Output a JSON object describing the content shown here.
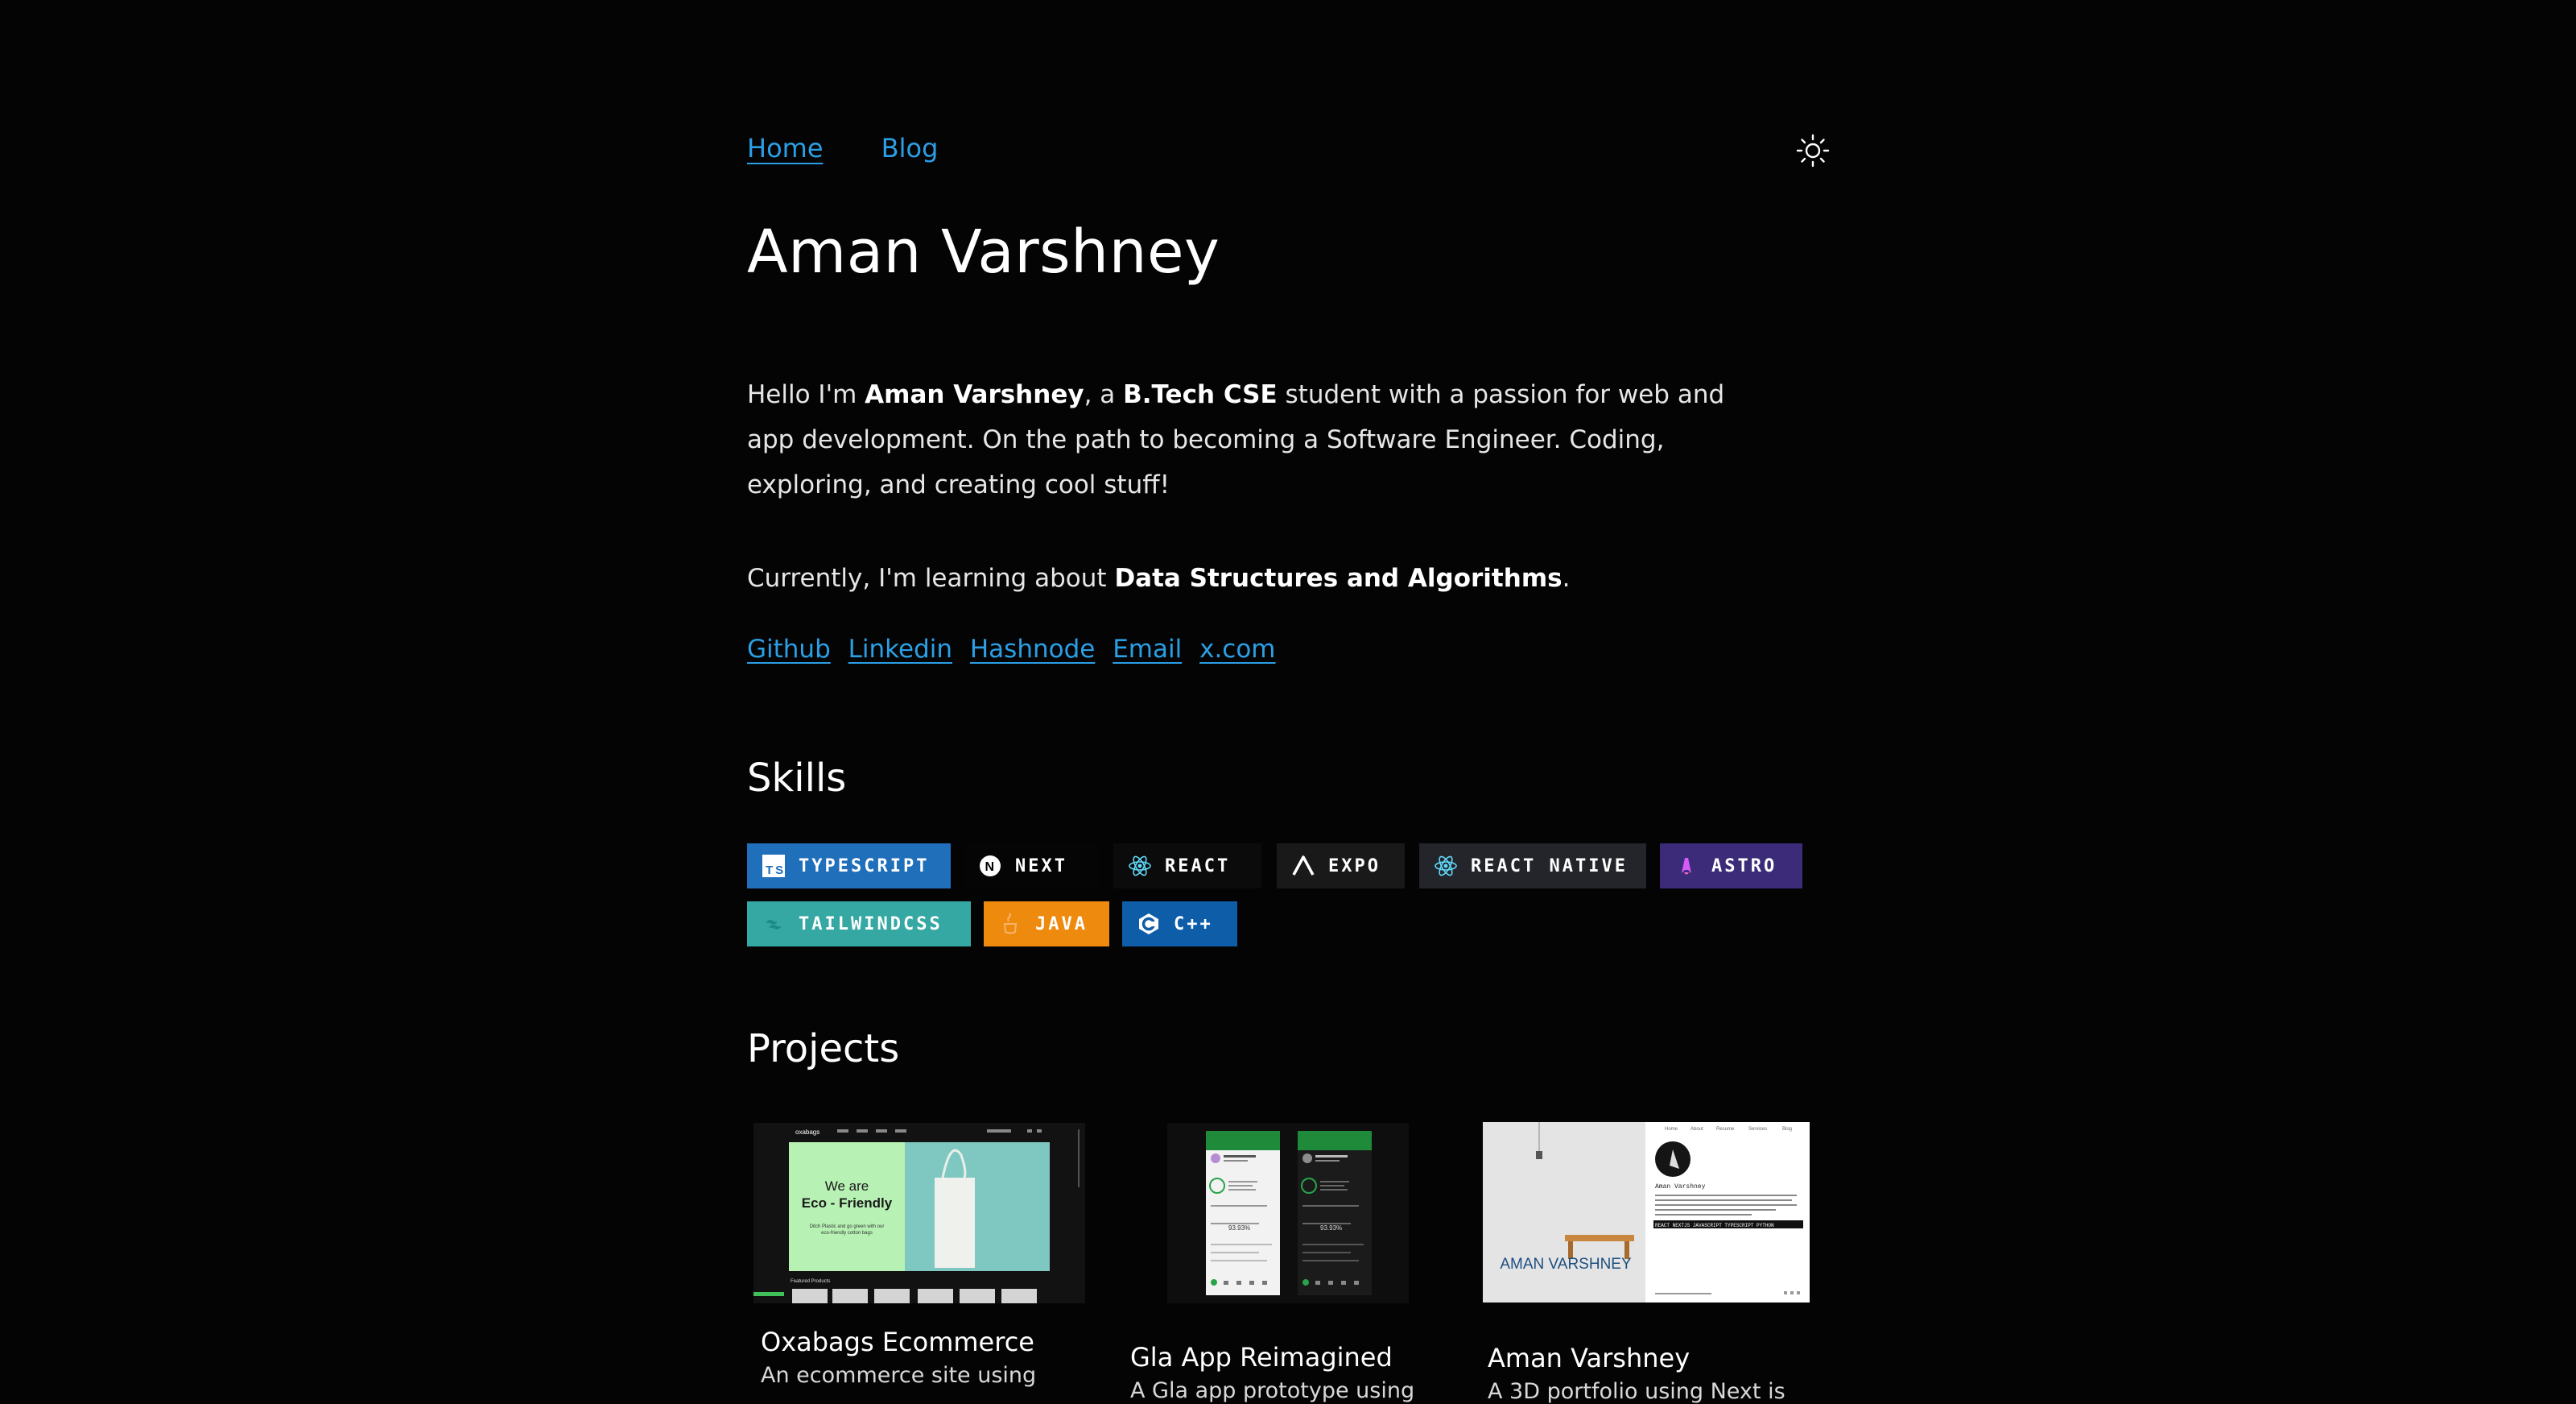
{
  "nav": {
    "home": "Home",
    "blog": "Blog",
    "theme_icon": "sun-icon"
  },
  "header": {
    "name": "Aman Varshney"
  },
  "intro": {
    "p1_a": "Hello I'm ",
    "p1_name": "Aman Varshney",
    "p1_b": ", a ",
    "p1_degree": "B.Tech CSE",
    "p1_c": " student with a passion for web and app development. On the path to becoming a Software Engineer. Coding, exploring, and creating cool stuff!",
    "p2_a": "Currently, I'm learning about ",
    "p2_topic": "Data Structures and Algorithms",
    "p2_b": "."
  },
  "links": [
    "Github",
    "Linkedin",
    "Hashnode",
    "Email",
    "x.com"
  ],
  "skills": {
    "heading": "Skills",
    "badges": [
      {
        "label": "TYPESCRIPT",
        "icon": "typescript-icon",
        "bg": "#1f6fba"
      },
      {
        "label": "NEXT",
        "icon": "nextjs-icon",
        "bg": "#050505"
      },
      {
        "label": "REACT",
        "icon": "react-icon",
        "bg": "#0b0b0b"
      },
      {
        "label": "EXPO",
        "icon": "expo-icon",
        "bg": "#191919"
      },
      {
        "label": "REACT NATIVE",
        "icon": "react-icon",
        "bg": "#23252b"
      },
      {
        "label": "ASTRO",
        "icon": "astro-icon",
        "bg": "#3c2b78"
      },
      {
        "label": "TAILWINDCSS",
        "icon": "tailwind-icon",
        "bg": "#35a8a4"
      },
      {
        "label": "JAVA",
        "icon": "java-icon",
        "bg": "#ee8a0e"
      },
      {
        "label": "C++",
        "icon": "cpp-icon",
        "bg": "#0e5da8"
      }
    ]
  },
  "projects": {
    "heading": "Projects",
    "items": [
      {
        "title": "Oxabags Ecommerce",
        "description": "An ecommerce site using",
        "thumb": {
          "brand": "oxabags",
          "headline_1": "We are",
          "headline_2": "Eco - Friendly",
          "sub_1": "Ditch Plastic and go green with our",
          "sub_2": "eco-friendly cotton bags",
          "section": "Featured Products"
        }
      },
      {
        "title": "Gla App Reimagined",
        "description": "A Gla app prototype using",
        "thumb": {
          "percent": "93.93%"
        }
      },
      {
        "title": "Aman Varshney",
        "description": "A 3D portfolio using Next is",
        "thumb": {
          "banner": "AMAN VARSHNEY",
          "nav": [
            "Home",
            "About",
            "Resume",
            "Services",
            "Blog"
          ],
          "name": "Aman Varshney",
          "tags": "REACT NEXTJS JAVASCRIPT TYPESCRIPT PYTHON"
        }
      }
    ]
  }
}
